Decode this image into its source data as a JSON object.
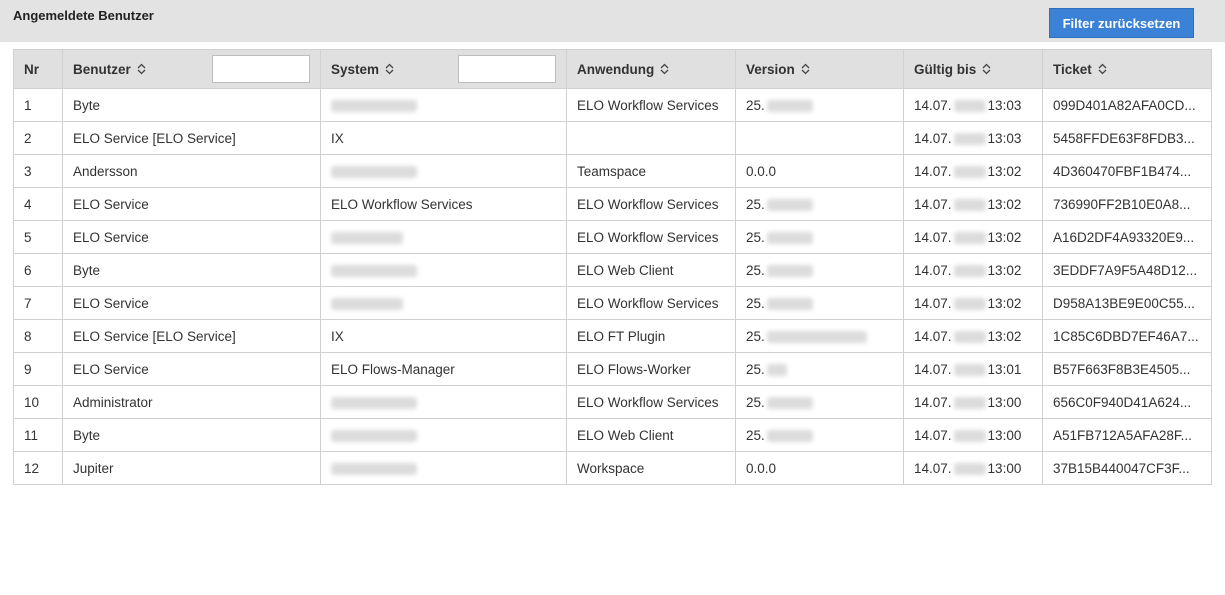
{
  "header": {
    "title": "Angemeldete Benutzer",
    "reset_button": "Filter zurücksetzen"
  },
  "table": {
    "columns": [
      {
        "label": "Nr"
      },
      {
        "label": "Benutzer",
        "sortable": true,
        "filter": ""
      },
      {
        "label": "System",
        "sortable": true,
        "filter": ""
      },
      {
        "label": "Anwendung",
        "sortable": true
      },
      {
        "label": "Version",
        "sortable": true
      },
      {
        "label": "Gültig bis",
        "sortable": true
      },
      {
        "label": "Ticket",
        "sortable": true
      }
    ],
    "rows": [
      {
        "nr": "1",
        "user": "Byte",
        "system": "",
        "system_blurred": "ip",
        "app": "ELO Workflow Services",
        "version": "25.",
        "version_blur": "short",
        "date": "14.07.",
        "time": "13:03",
        "ticket": "099D401A82AFA0CD..."
      },
      {
        "nr": "2",
        "user": "ELO Service [ELO Service]",
        "system": "IX",
        "system_blurred": "",
        "app": "",
        "version": "",
        "version_blur": "",
        "date": "14.07.",
        "time": "13:03",
        "ticket": "5458FFDE63F8FDB3..."
      },
      {
        "nr": "3",
        "user": "Andersson",
        "system": "",
        "system_blurred": "ip",
        "app": "Teamspace",
        "version": "0.0.0",
        "version_blur": "",
        "date": "14.07.",
        "time": "13:02",
        "ticket": "4D360470FBF1B474..."
      },
      {
        "nr": "4",
        "user": "ELO Service",
        "system": "ELO Workflow Services",
        "system_blurred": "",
        "app": "ELO Workflow Services",
        "version": "25.",
        "version_blur": "short",
        "date": "14.07.",
        "time": "13:02",
        "ticket": "736990FF2B10E0A8..."
      },
      {
        "nr": "5",
        "user": "ELO Service",
        "system": "",
        "system_blurred": "host",
        "app": "ELO Workflow Services",
        "version": "25.",
        "version_blur": "short",
        "date": "14.07.",
        "time": "13:02",
        "ticket": "A16D2DF4A93320E9..."
      },
      {
        "nr": "6",
        "user": "Byte",
        "system": "",
        "system_blurred": "ip",
        "app": "ELO Web Client",
        "version": "25.",
        "version_blur": "short",
        "date": "14.07.",
        "time": "13:02",
        "ticket": "3EDDF7A9F5A48D12..."
      },
      {
        "nr": "7",
        "user": "ELO Service",
        "system": "",
        "system_blurred": "host",
        "app": "ELO Workflow Services",
        "version": "25.",
        "version_blur": "short",
        "date": "14.07.",
        "time": "13:02",
        "ticket": "D958A13BE9E00C55..."
      },
      {
        "nr": "8",
        "user": "ELO Service [ELO Service]",
        "system": "IX",
        "system_blurred": "",
        "app": "ELO FT Plugin",
        "version": "25.",
        "version_blur": "long",
        "date": "14.07.",
        "time": "13:02",
        "ticket": "1C85C6DBD7EF46A7..."
      },
      {
        "nr": "9",
        "user": "ELO Service",
        "system": "ELO Flows-Manager",
        "system_blurred": "",
        "app": "ELO Flows-Worker",
        "version": "25.",
        "version_blur": "tiny",
        "date": "14.07.",
        "time": "13:01",
        "ticket": "B57F663F8B3E4505..."
      },
      {
        "nr": "10",
        "user": "Administrator",
        "system": "",
        "system_blurred": "ip",
        "app": "ELO Workflow Services",
        "version": "25.",
        "version_blur": "short",
        "date": "14.07.",
        "time": "13:00",
        "ticket": "656C0F940D41A624..."
      },
      {
        "nr": "11",
        "user": "Byte",
        "system": "",
        "system_blurred": "ip",
        "app": "ELO Web Client",
        "version": "25.",
        "version_blur": "short",
        "date": "14.07.",
        "time": "13:00",
        "ticket": "A51FB712A5AFA28F..."
      },
      {
        "nr": "12",
        "user": "Jupiter",
        "system": "",
        "system_blurred": "ip",
        "app": "Workspace",
        "version": "0.0.0",
        "version_blur": "",
        "date": "14.07.",
        "time": "13:00",
        "ticket": "37B15B440047CF3F..."
      }
    ]
  },
  "icons": {
    "sort": "sort-icon"
  },
  "colors": {
    "accent": "#3b82d6",
    "header_bg": "#e0e0e0",
    "topbar_bg": "#e3e3e3"
  }
}
